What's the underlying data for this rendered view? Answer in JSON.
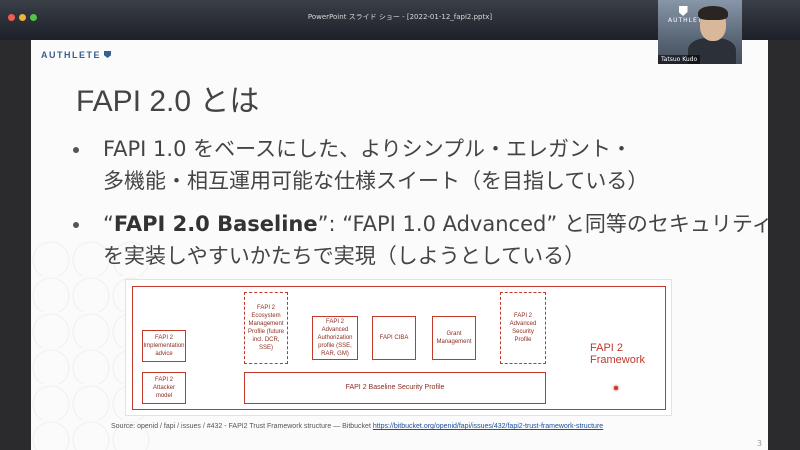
{
  "window": {
    "title": "PowerPoint スライド ショー - [2022-01-12_fapi2.pptx]"
  },
  "webcam": {
    "logo_text": "AUTHLETE",
    "participant_name": "Tatsuo Kudo"
  },
  "slide": {
    "brand": "AUTHLETE",
    "title": "FAPI 2.0 とは",
    "bullets": [
      {
        "line1": "FAPI 1.0 をベースにした、よりシンプル・エレガント・",
        "line2": "多機能・相互運用可能な仕様スイート（を目指している）"
      },
      {
        "bold": "FAPI 2.0 Baseline",
        "line1_rest": "”: “FAPI 1.0 Advanced” と同等のセキュリティ",
        "open_quote": "“",
        "line2": "を実装しやすいかたちで実現（しようとしている）"
      }
    ],
    "diagram": {
      "boxes": {
        "implementation_advice": "FAPI 2 Implementation advice",
        "attacker_model": "FAPI 2 Attacker model",
        "ecosystem_profile": "FAPI 2 Ecosystem Management Profile (future incl. DCR, SSE)",
        "advanced_auth_profile": "FAPI 2 Advanced Authorization profile (SSE, RAR, GM)",
        "ciba": "FAPI CIBA",
        "grant_management": "Grant Management",
        "advanced_security_profile": "FAPI 2 Advanced Security Profile",
        "baseline_security_profile": "FAPI 2 Baseline Security Profile"
      },
      "framework_label": "FAPI 2 Framework"
    },
    "source_prefix": "Source: openid / fapi / issues / #432 - FAPI2 Trust Framework structure — Bitbucket",
    "source_link": "https://bitbucket.org/openid/fapi/issues/432/fapi2-trust-framework-structure",
    "page_number": "3"
  },
  "colors": {
    "accent_red": "#c0392b",
    "brand_blue": "#3a5f8c"
  }
}
